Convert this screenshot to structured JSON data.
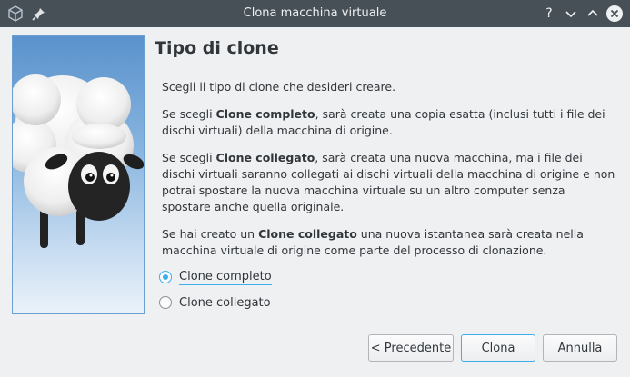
{
  "window": {
    "title": "Clona macchina virtuale",
    "help_glyph": "?",
    "colors": {
      "titlebar": "#475057",
      "accent": "#3daee9"
    }
  },
  "page": {
    "title": "Tipo di clone",
    "intro": "Scegli il tipo di clone che desideri creare.",
    "full_para": {
      "pre": "Se scegli ",
      "bold": "Clone completo",
      "post": ", sarà creata una copia esatta (inclusi tutti i file dei dischi virtuali) della macchina di origine."
    },
    "linked_para": {
      "pre": "Se scegli ",
      "bold": "Clone collegato",
      "post": ", sarà creata una nuova macchina, ma i file dei dischi virtuali saranno collegati ai dischi virtuali della macchina di origine e non potrai spostare la nuova macchina virtuale su un altro computer senza spostare anche quella originale."
    },
    "snapshot_para": {
      "pre": "Se hai creato un ",
      "bold": "Clone collegato",
      "post": " una nuova istantanea sarà creata nella macchina virtuale di origine come parte del processo di clonazione."
    },
    "options": [
      {
        "label": "Clone completo",
        "checked": true
      },
      {
        "label": "Clone collegato",
        "checked": false
      }
    ]
  },
  "buttons": {
    "back": "< Precedente",
    "clone": "Clona",
    "cancel": "Annulla"
  }
}
